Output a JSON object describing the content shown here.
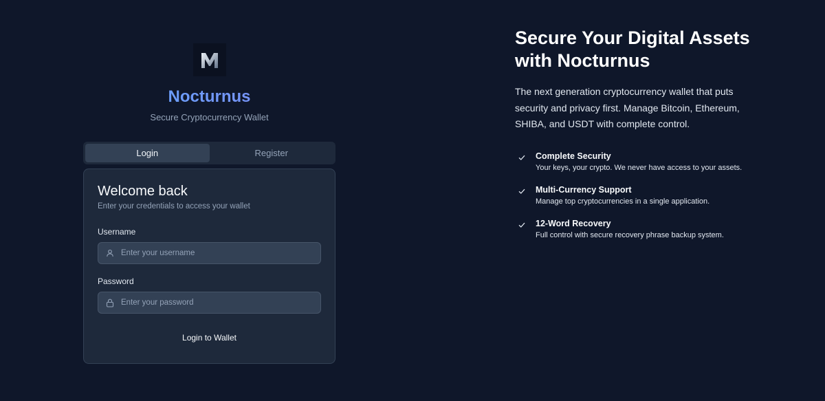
{
  "brand": {
    "name": "Nocturnus",
    "tagline": "Secure Cryptocurrency Wallet"
  },
  "tabs": [
    {
      "label": "Login",
      "active": true
    },
    {
      "label": "Register",
      "active": false
    }
  ],
  "login_card": {
    "title": "Welcome back",
    "subtitle": "Enter your credentials to access your wallet",
    "username_label": "Username",
    "username_placeholder": "Enter your username",
    "password_label": "Password",
    "password_placeholder": "Enter your password",
    "submit_label": "Login to Wallet"
  },
  "hero": {
    "title": "Secure Your Digital Assets with Nocturnus",
    "description": "The next generation cryptocurrency wallet that puts security and privacy first. Manage Bitcoin, Ethereum, SHIBA, and USDT with complete control.",
    "features": [
      {
        "title": "Complete Security",
        "description": "Your keys, your crypto. We never have access to your assets."
      },
      {
        "title": "Multi-Currency Support",
        "description": "Manage top cryptocurrencies in a single application."
      },
      {
        "title": "12-Word Recovery",
        "description": "Full control with secure recovery phrase backup system."
      }
    ]
  },
  "icons": {
    "logo": "nocturnus-logo-icon",
    "username": "user-icon",
    "password": "lock-icon",
    "feature_bullet": "check-icon"
  },
  "colors": {
    "background": "#0f172a",
    "card": "#1e293b",
    "input": "#334155",
    "brand_gradient_start": "#60a5fa",
    "brand_gradient_end": "#818cf8"
  }
}
